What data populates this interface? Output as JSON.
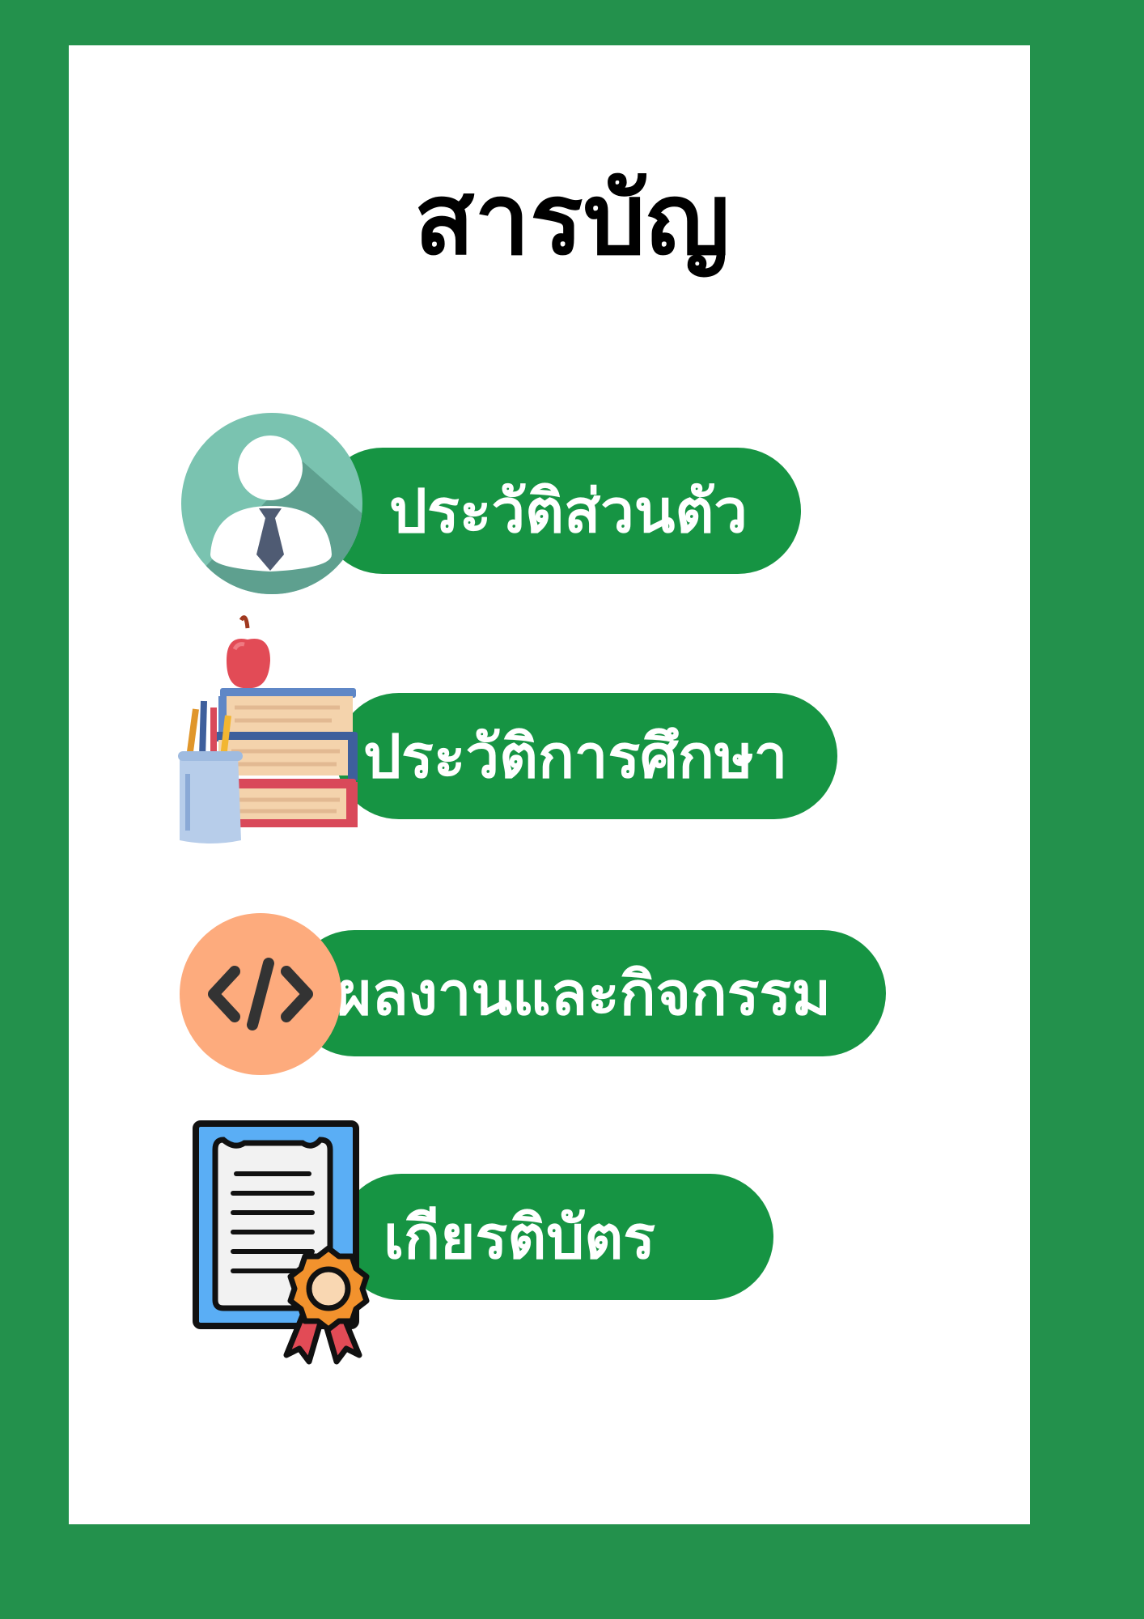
{
  "page": {
    "title": "สารบัญ"
  },
  "menu": {
    "items": [
      {
        "label": "ประวัติส่วนตัว",
        "icon": "user-avatar-icon"
      },
      {
        "label": "ประวัติการศึกษา",
        "icon": "books-education-icon"
      },
      {
        "label": "ผลงานและกิจกรรม",
        "icon": "code-icon"
      },
      {
        "label": "เกียรติบัตร",
        "icon": "certificate-icon"
      }
    ]
  },
  "colors": {
    "background": "#23914c",
    "card": "#ffffff",
    "pill": "#169443",
    "text_on_pill": "#ffffff"
  }
}
